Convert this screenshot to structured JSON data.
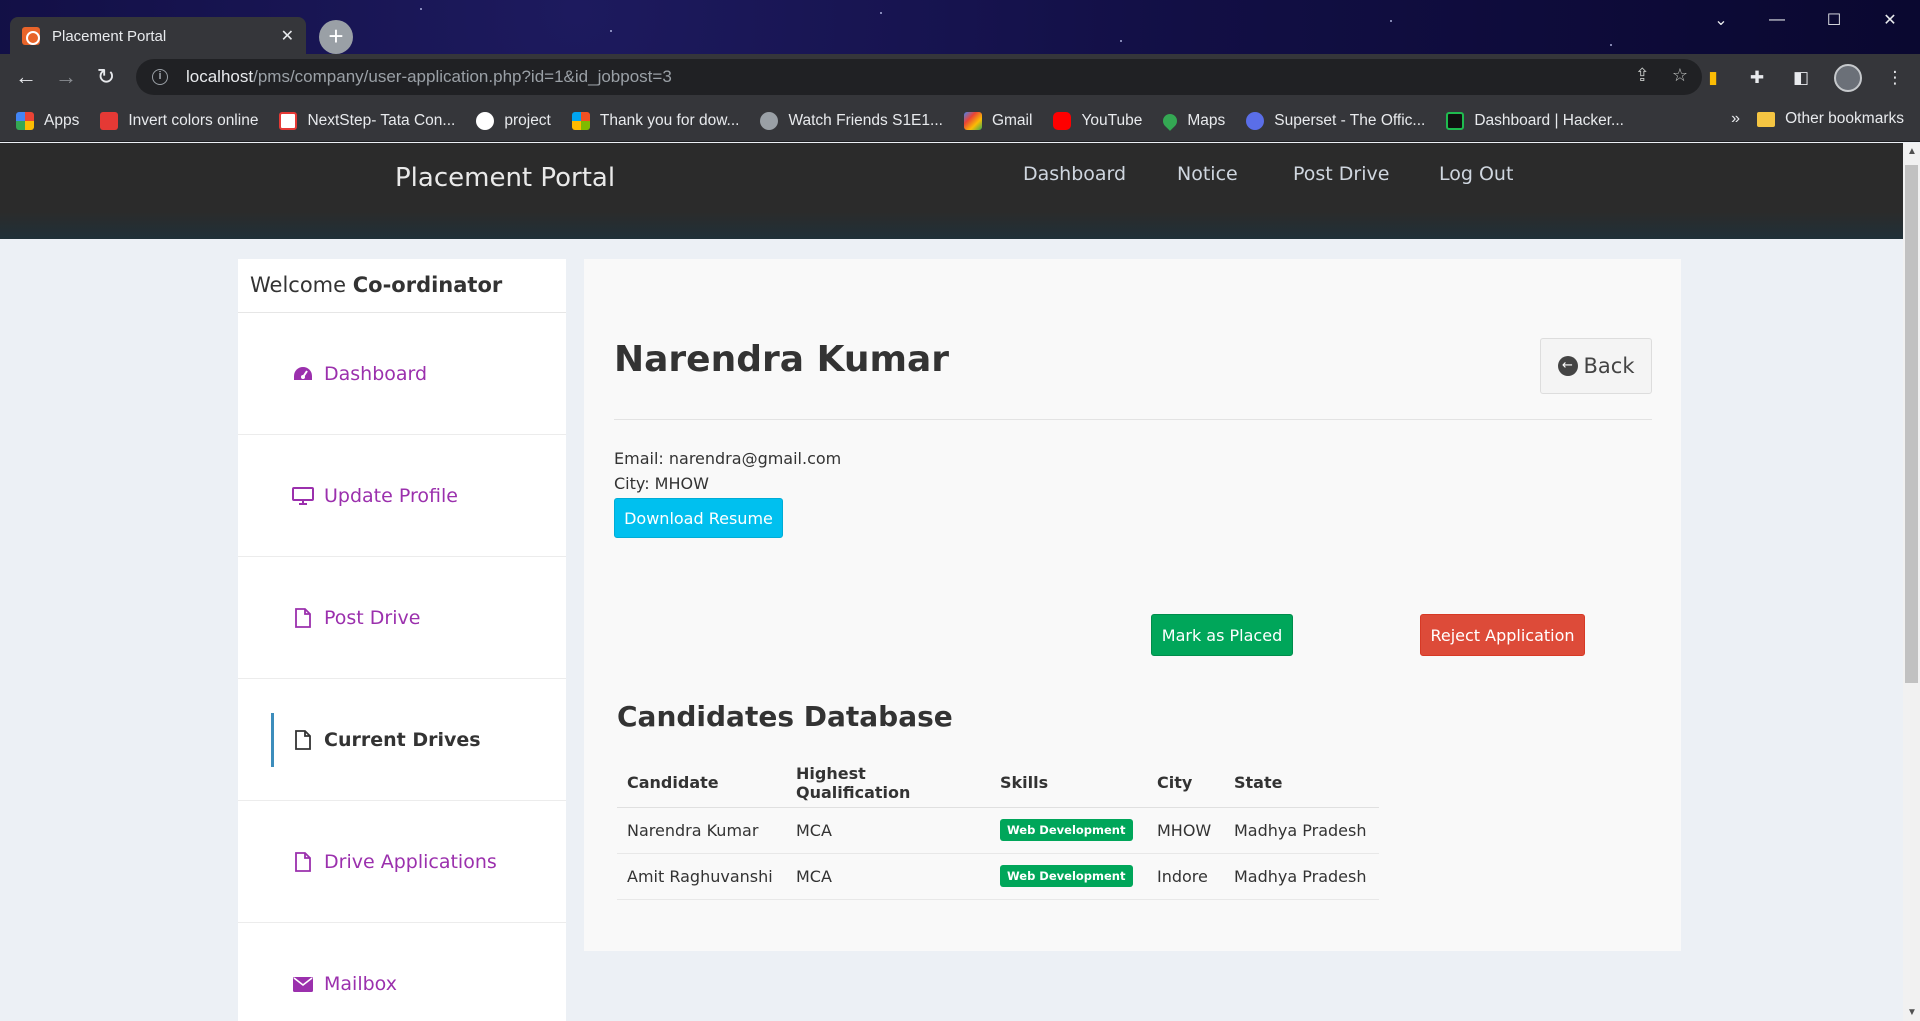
{
  "browser": {
    "tab_title": "Placement Portal",
    "tab_close": "✕",
    "new_tab": "+",
    "url_host": "localhost",
    "url_path": "/pms/company/user-application.php?id=1&id_jobpost=3",
    "bookmarks": [
      {
        "label": "Apps",
        "color": "#4285f4"
      },
      {
        "label": "Invert colors online",
        "color": "#e53935"
      },
      {
        "label": "NextStep- Tata Con...",
        "color": "#e53935"
      },
      {
        "label": "project",
        "color": "#ffffff"
      },
      {
        "label": "Thank you for dow...",
        "color": "#fbbc04"
      },
      {
        "label": "Watch Friends S1E1...",
        "color": "#9aa0a6"
      },
      {
        "label": "Gmail",
        "color": "#ea4335"
      },
      {
        "label": "YouTube",
        "color": "#ff0000"
      },
      {
        "label": "Maps",
        "color": "#34a853"
      },
      {
        "label": "Superset - The Offic...",
        "color": "#5a6ee8"
      },
      {
        "label": "Dashboard | Hacker...",
        "color": "#1fbb4f"
      }
    ],
    "bookmarks_more": "»",
    "other_bookmarks": "Other bookmarks"
  },
  "header": {
    "brand": "Placement Portal",
    "nav": [
      "Dashboard",
      "Notice",
      "Post Drive",
      "Log Out"
    ]
  },
  "sidebar": {
    "welcome_prefix": "Welcome ",
    "welcome_role": "Co-ordinator",
    "items": [
      {
        "label": "Dashboard",
        "icon": "dashboard-icon"
      },
      {
        "label": "Update Profile",
        "icon": "desktop-icon"
      },
      {
        "label": "Post Drive",
        "icon": "file-icon"
      },
      {
        "label": "Current Drives",
        "icon": "file-icon",
        "active": true
      },
      {
        "label": "Drive Applications",
        "icon": "file-icon"
      },
      {
        "label": "Mailbox",
        "icon": "envelope-icon"
      }
    ]
  },
  "applicant": {
    "name": "Narendra Kumar",
    "back_label": "Back",
    "email_line": "Email: narendra@gmail.com",
    "city_line": "City: MHOW",
    "download_label": "Download Resume",
    "mark_placed_label": "Mark as Placed",
    "reject_label": "Reject Application"
  },
  "candidates": {
    "title": "Candidates Database",
    "columns": [
      "Candidate",
      "Highest Qualification",
      "Skills",
      "City",
      "State"
    ],
    "rows": [
      {
        "candidate": "Narendra Kumar",
        "qualification": "MCA",
        "skills": "Web Development",
        "city": "MHOW",
        "state": "Madhya Pradesh"
      },
      {
        "candidate": "Amit Raghuvanshi",
        "qualification": "MCA",
        "skills": "Web Development",
        "city": "Indore",
        "state": "Madhya Pradesh"
      }
    ]
  },
  "colors": {
    "accent_purple": "#9b30ad",
    "info": "#00c0ef",
    "success": "#00a65a",
    "danger": "#dd4b39"
  }
}
